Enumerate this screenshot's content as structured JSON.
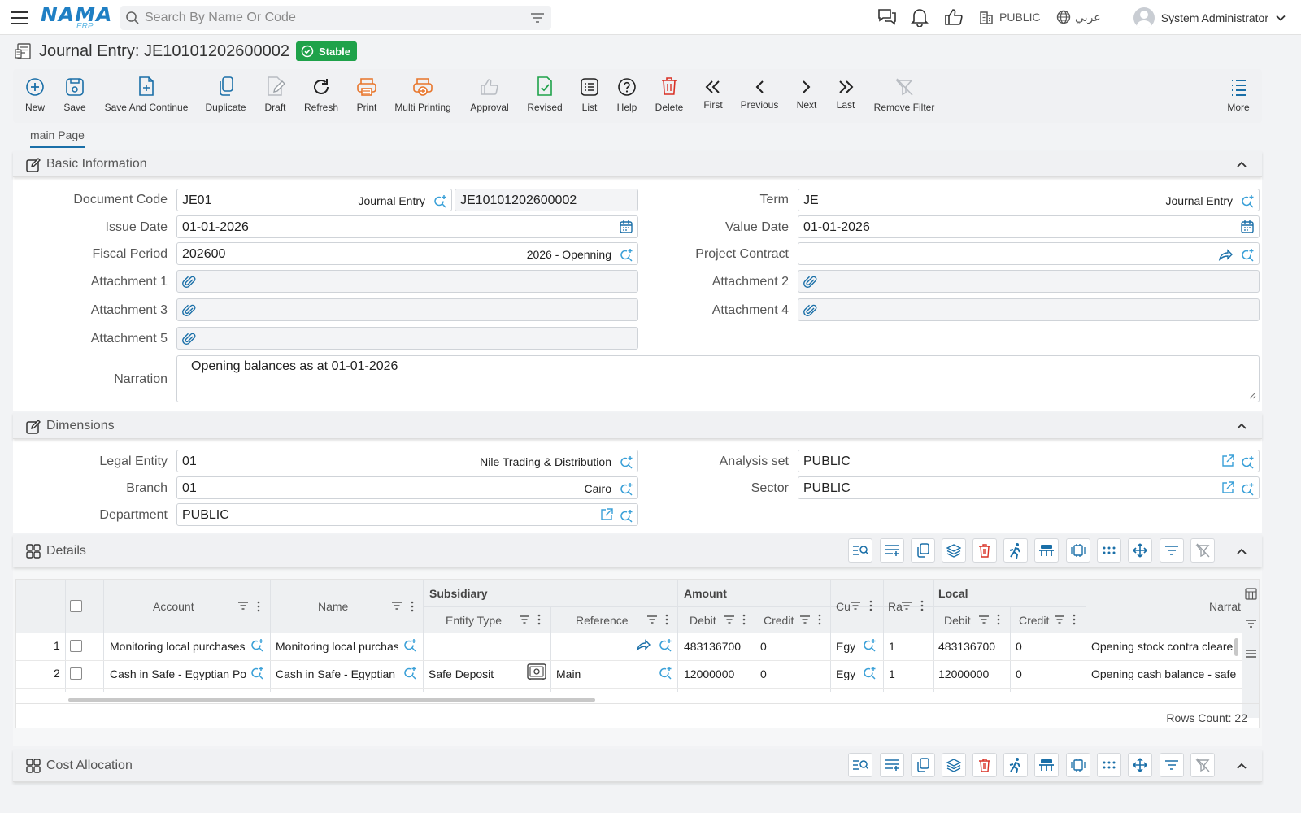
{
  "topbar": {
    "logo_main": "NAMA",
    "logo_sub": "ERP",
    "search_placeholder": "Search By Name Or Code",
    "company": "PUBLIC",
    "language": "عربي",
    "user": "System Administrator"
  },
  "title": {
    "text": "Journal Entry: JE10101202600002",
    "status": "Stable"
  },
  "toolbar": [
    {
      "label": "New",
      "icon": "plus-circle-icon",
      "color": "#1a6fa8"
    },
    {
      "label": "Save",
      "icon": "save-icon",
      "color": "#1a6fa8"
    },
    {
      "label": "Save And Continue",
      "icon": "save-continue-icon",
      "color": "#1a6fa8"
    },
    {
      "label": "Duplicate",
      "icon": "duplicate-icon",
      "color": "#1a6fa8"
    },
    {
      "label": "Draft",
      "icon": "draft-icon",
      "color": "#9aa0a6"
    },
    {
      "label": "Refresh",
      "icon": "refresh-icon",
      "color": "#222222"
    },
    {
      "label": "Print",
      "icon": "print-icon",
      "color": "#e8752a"
    },
    {
      "label": "Multi Printing",
      "icon": "multi-print-icon",
      "color": "#e8752a"
    },
    {
      "label": "Approval",
      "icon": "thumbs-up-icon",
      "color": "#9aa0a6"
    },
    {
      "label": "Revised",
      "icon": "revised-icon",
      "color": "#1fa24a"
    },
    {
      "label": "List",
      "icon": "list-icon",
      "color": "#222222"
    },
    {
      "label": "Help",
      "icon": "help-icon",
      "color": "#222222"
    },
    {
      "label": "Delete",
      "icon": "trash-icon",
      "color": "#d93025"
    },
    {
      "label": "First",
      "icon": "first-icon",
      "color": "#222222"
    },
    {
      "label": "Previous",
      "icon": "previous-icon",
      "color": "#222222"
    },
    {
      "label": "Next",
      "icon": "next-icon",
      "color": "#222222"
    },
    {
      "label": "Last",
      "icon": "last-icon",
      "color": "#222222"
    },
    {
      "label": "Remove Filter",
      "icon": "remove-filter-icon",
      "color": "#9aa0a6"
    },
    {
      "label": "More",
      "icon": "more-icon",
      "color": "#1a6fa8"
    }
  ],
  "tabs": [
    "main Page"
  ],
  "basic": {
    "title": "Basic Information",
    "document_code_label": "Document Code",
    "document_code": "JE01",
    "document_code_desc": "Journal Entry",
    "document_number": "JE10101202600002",
    "term_label": "Term",
    "term": "JE",
    "term_desc": "Journal Entry",
    "issue_date_label": "Issue Date",
    "issue_date": "01-01-2026",
    "value_date_label": "Value Date",
    "value_date": "01-01-2026",
    "fiscal_period_label": "Fiscal Period",
    "fiscal_period": "202600",
    "fiscal_period_desc": "2026 - Openning",
    "project_contract_label": "Project Contract",
    "project_contract": "",
    "attachment1_label": "Attachment 1",
    "attachment2_label": "Attachment 2",
    "attachment3_label": "Attachment 3",
    "attachment4_label": "Attachment 4",
    "attachment5_label": "Attachment 5",
    "narration_label": "Narration",
    "narration": "Opening balances as at 01-01-2026"
  },
  "dimensions": {
    "title": "Dimensions",
    "legal_entity_label": "Legal Entity",
    "legal_entity": "01",
    "legal_entity_desc": "Nile Trading & Distribution",
    "analysis_set_label": "Analysis set",
    "analysis_set": "PUBLIC",
    "branch_label": "Branch",
    "branch": "01",
    "branch_desc": "Cairo",
    "sector_label": "Sector",
    "sector": "PUBLIC",
    "department_label": "Department",
    "department": "PUBLIC"
  },
  "details": {
    "title": "Details",
    "headers": {
      "account": "Account",
      "name": "Name",
      "subsidiary": "Subsidiary",
      "entity_type": "Entity Type",
      "reference": "Reference",
      "amount": "Amount",
      "debit": "Debit",
      "credit": "Credit",
      "currency": "Cu",
      "rate": "Ra",
      "local": "Local",
      "local_debit": "Debit",
      "local_credit": "Credit",
      "narration": "Narrat"
    },
    "rows": [
      {
        "num": "1",
        "account": "Monitoring local purchases",
        "name": "Monitoring local purchas",
        "entity_type": "",
        "reference": "",
        "debit": "483136700",
        "credit": "0",
        "currency": "Egy",
        "rate": "1",
        "local_debit": "483136700",
        "local_credit": "0",
        "narration": "Opening stock contra cleare"
      },
      {
        "num": "2",
        "account": "Cash in Safe - Egyptian Po",
        "name": "Cash in Safe - Egyptian I",
        "entity_type": "Safe Deposit",
        "reference": "Main",
        "debit": "12000000",
        "credit": "0",
        "currency": "Egy",
        "rate": "1",
        "local_debit": "12000000",
        "local_credit": "0",
        "narration": "Opening cash balance - safe"
      }
    ],
    "rows_count": "Rows Count: 22"
  },
  "cost_allocation": {
    "title": "Cost Allocation"
  },
  "colors": {
    "accent": "#1a6fa8",
    "lookup": "#3aa0d8",
    "status_green": "#1fa24a",
    "print_orange": "#e8752a",
    "delete_red": "#d93025"
  }
}
